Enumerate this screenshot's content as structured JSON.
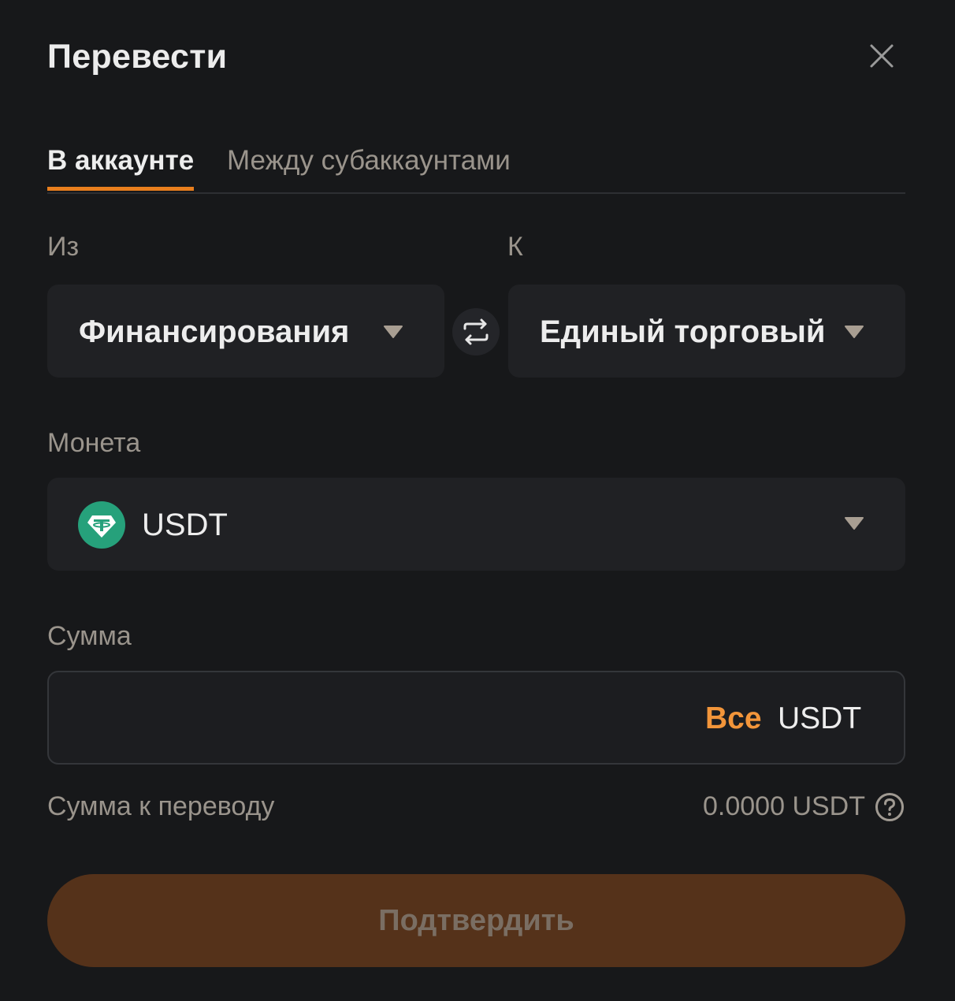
{
  "dialog": {
    "title": "Перевести"
  },
  "tabs": [
    {
      "label": "В аккаунте",
      "active": true
    },
    {
      "label": "Между субаккаунтами",
      "active": false
    }
  ],
  "from": {
    "label": "Из",
    "value": "Финансирования"
  },
  "to": {
    "label": "К",
    "value": "Единый торговый"
  },
  "coin": {
    "label": "Монета",
    "value": "USDT",
    "icon": "tether-icon"
  },
  "amount": {
    "label": "Сумма",
    "value": "",
    "placeholder": "",
    "max_label": "Все",
    "unit": "USDT"
  },
  "summary": {
    "label": "Сумма к переводу",
    "value": "0.0000 USDT"
  },
  "confirm": {
    "label": "Подтвердить"
  },
  "colors": {
    "background": "#17181a",
    "accent": "#e87e1d",
    "max_link": "#f2953a",
    "confirm_bg": "#55321a",
    "tether": "#26a17b"
  }
}
